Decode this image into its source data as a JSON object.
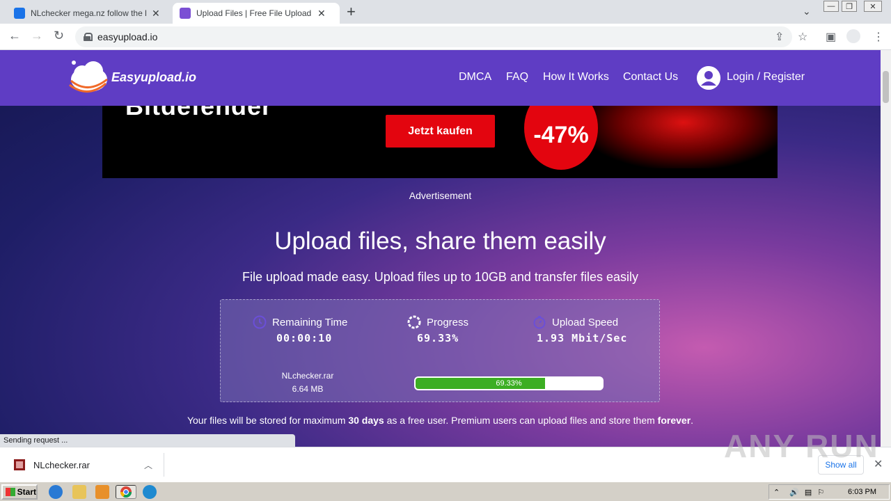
{
  "browser": {
    "tabs": [
      {
        "title": "NLchecker mega.nz follow the link —",
        "close": "✕",
        "active": false
      },
      {
        "title": "Upload Files | Free File Upload and Tr",
        "close": "✕",
        "active": true
      }
    ],
    "new_tab": "+",
    "tab_dropdown": "⌄",
    "window_buttons": [
      "—",
      "❐",
      "✕"
    ],
    "url": "easyupload.io",
    "status_text": "Sending request ..."
  },
  "site": {
    "logo_text": "Easyupload.io",
    "nav": [
      "DMCA",
      "FAQ",
      "How It Works",
      "Contact Us"
    ],
    "login": "Login / Register",
    "colors": {
      "nav_bg": "#5f3dc4",
      "progress_fill": "#3cae23",
      "ad_red": "#e3050f"
    }
  },
  "ad": {
    "brand": "Bitdefender",
    "buy_button": "Jetzt kaufen",
    "discount": "-47%",
    "label": "Advertisement"
  },
  "main": {
    "heading": "Upload files, share them easily",
    "subheading": "File upload made easy. Upload files up to 10GB and transfer files easily",
    "stats": {
      "remaining_label": "Remaining Time",
      "remaining_value": "00:00:10",
      "progress_label": "Progress",
      "progress_value": "69.33%",
      "speed_label": "Upload Speed",
      "speed_value": "1.93 Mbit/Sec"
    },
    "file_name": "NLchecker.rar",
    "file_size": "6.64 MB",
    "progress_fraction": 0.6933,
    "progress_text": "69.33%",
    "footnote_a": "Your files will be stored for maximum ",
    "footnote_b": "30 days",
    "footnote_c": " as a free user. Premium users can upload files and store them ",
    "footnote_d": "forever",
    "footnote_e": "."
  },
  "downloads": {
    "file": "NLchecker.rar",
    "show_all": "Show all",
    "close": "✕"
  },
  "watermark": "ANY RUN",
  "taskbar": {
    "start": "Start",
    "clock": "6:03 PM"
  }
}
